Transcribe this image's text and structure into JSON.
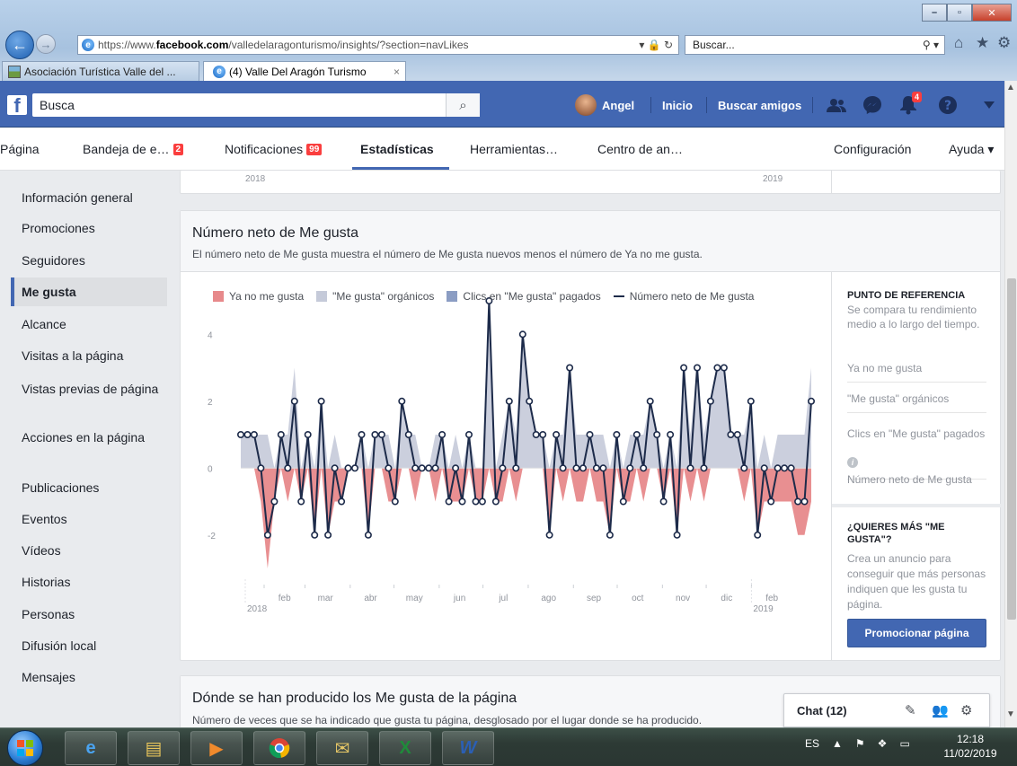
{
  "browser": {
    "url_prefix": "https://www.",
    "url_domain": "facebook.com",
    "url_path": "/valledelaragonturismo/insights/?section=navLikes",
    "addr_tools": "▾ 🔒 ↻",
    "search_placeholder": "Buscar...",
    "tabs": [
      {
        "label": "Asociación Turística Valle del ..."
      },
      {
        "label": "(4) Valle Del Aragón Turismo"
      }
    ],
    "close_glyph": "×"
  },
  "fb": {
    "logo": "f",
    "search_value": "Busca",
    "user_name": "Angel",
    "links": [
      "Inicio",
      "Buscar amigos"
    ],
    "notifications_badge": "4"
  },
  "page_nav": {
    "items": [
      "Página",
      "Bandeja de e…",
      "Notificaciones",
      "Estadísticas",
      "Herramientas…",
      "Centro de an…",
      "Configuración",
      "Ayuda ▾"
    ],
    "inbox_count": "2",
    "notif_count": "99"
  },
  "sidebar": {
    "items": [
      "Información general",
      "Promociones",
      "Seguidores",
      "Me gusta",
      "Alcance",
      "Visitas a la página",
      "Vistas previas de página",
      "Acciones en la página",
      "Publicaciones",
      "Eventos",
      "Vídeos",
      "Historias",
      "Personas",
      "Difusión local",
      "Mensajes"
    ],
    "active_index": 3
  },
  "top_card": {
    "year_start": "2018",
    "year_end": "2019"
  },
  "likes_card": {
    "title": "Número neto de Me gusta",
    "description": "El número neto de Me gusta muestra el número de Me gusta nuevos menos el número de Ya no me gusta."
  },
  "chart_data": {
    "type": "line",
    "title": "Número neto de Me gusta",
    "legend": [
      "Ya no me gusta",
      "\"Me gusta\" orgánicos",
      "Clics en \"Me gusta\" pagados",
      "Número neto de Me gusta"
    ],
    "legend_placement": "top",
    "colors": {
      "unlikes": "#e7898b",
      "organic": "#c5cad9",
      "paid": "#8b9dc3",
      "net": "#1d2b4a"
    },
    "ylim": [
      -3,
      5
    ],
    "yticks": [
      -2,
      0,
      2,
      4
    ],
    "months": [
      "feb",
      "mar",
      "abr",
      "may",
      "jun",
      "jul",
      "ago",
      "sep",
      "oct",
      "nov",
      "dic",
      "feb"
    ],
    "year_labels": [
      "2018",
      "2019"
    ],
    "x_range": [
      "2018-01-16",
      "2019-02-11"
    ],
    "grid": false,
    "series": [
      {
        "name": "Número neto de Me gusta",
        "values": [
          1,
          1,
          1,
          0,
          -2,
          -1,
          1,
          0,
          2,
          -1,
          1,
          -2,
          2,
          -2,
          0,
          -1,
          0,
          0,
          1,
          -2,
          1,
          1,
          0,
          -1,
          2,
          1,
          0,
          0,
          0,
          0,
          1,
          -1,
          0,
          -1,
          1,
          -1,
          -1,
          5,
          -1,
          0,
          2,
          0,
          4,
          2,
          1,
          1,
          -2,
          1,
          0,
          3,
          0,
          0,
          1,
          0,
          0,
          -2,
          1,
          -1,
          0,
          1,
          0,
          2,
          1,
          -1,
          1,
          -2,
          3,
          0,
          3,
          0,
          2,
          3,
          3,
          1,
          1,
          0,
          2,
          -2,
          0,
          -1,
          0,
          0,
          0,
          -1,
          -1,
          2
        ]
      },
      {
        "name": "Ya no me gusta",
        "values": [
          0,
          0,
          0,
          -1,
          -3,
          -1,
          0,
          -1,
          0,
          -1,
          0,
          -2,
          0,
          -2,
          -1,
          -1,
          0,
          0,
          0,
          -2,
          0,
          0,
          -1,
          -1,
          0,
          0,
          -1,
          0,
          0,
          -1,
          0,
          -1,
          -1,
          -1,
          0,
          -1,
          -1,
          0,
          -1,
          -1,
          0,
          -1,
          0,
          0,
          0,
          0,
          -2,
          0,
          -1,
          0,
          -1,
          -1,
          0,
          -1,
          -1,
          -2,
          0,
          -1,
          -1,
          0,
          -1,
          0,
          0,
          -1,
          0,
          -2,
          0,
          -1,
          0,
          -1,
          0,
          0,
          0,
          0,
          0,
          -1,
          0,
          -2,
          -1,
          -1,
          -1,
          -1,
          -1,
          -2,
          -2,
          -1
        ]
      },
      {
        "name": "\"Me gusta\" orgánicos",
        "values": [
          1,
          1,
          1,
          1,
          1,
          0,
          1,
          1,
          3,
          0,
          1,
          0,
          2,
          0,
          1,
          0,
          0,
          0,
          1,
          0,
          1,
          1,
          1,
          0,
          2,
          1,
          1,
          0,
          0,
          1,
          1,
          0,
          1,
          0,
          1,
          0,
          0,
          5,
          0,
          1,
          2,
          1,
          4,
          2,
          1,
          1,
          0,
          1,
          1,
          3,
          1,
          1,
          1,
          1,
          1,
          0,
          1,
          0,
          1,
          1,
          1,
          2,
          1,
          0,
          1,
          0,
          3,
          1,
          3,
          1,
          2,
          3,
          3,
          1,
          1,
          1,
          2,
          0,
          1,
          0,
          1,
          1,
          1,
          1,
          1,
          3
        ]
      }
    ]
  },
  "ref_panel": {
    "title": "PUNTO DE REFERENCIA",
    "subtitle": "Se compara tu rendimiento medio a lo largo del tiempo.",
    "items": [
      "Ya no me gusta",
      "\"Me gusta\" orgánicos",
      "Clics en \"Me gusta\" pagados",
      "Número neto de Me gusta"
    ],
    "promo_title": "¿QUIERES MÁS \"ME GUSTA\"?",
    "promo_text": "Crea un anuncio para conseguir que más personas indiquen que les gusta tu página.",
    "promo_button": "Promocionar página"
  },
  "where_card": {
    "title": "Dónde se han producido los Me gusta de la página",
    "description": "Número de veces que se ha indicado que gusta tu página, desglosado por el lugar donde se ha producido."
  },
  "chat": {
    "label": "Chat (12)"
  },
  "taskbar": {
    "lang": "ES",
    "time": "12:18",
    "date": "11/02/2019"
  }
}
